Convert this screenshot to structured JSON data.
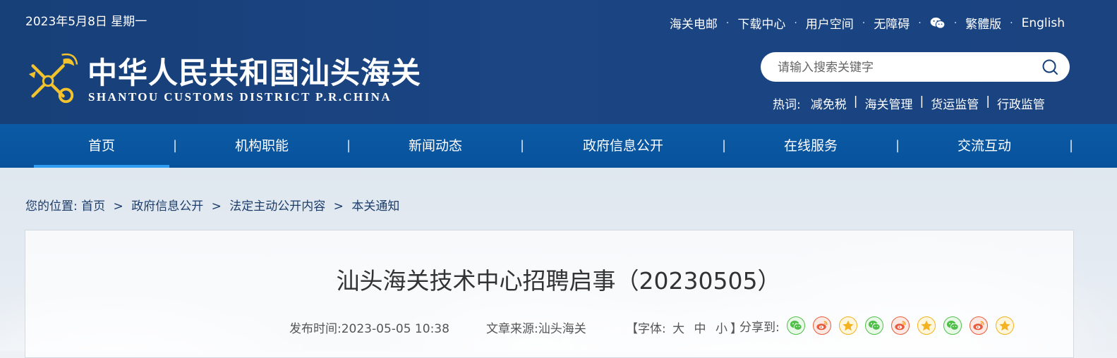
{
  "header": {
    "date": "2023年5月8日 星期一",
    "top_links": [
      "海关电邮",
      "下载中心",
      "用户空间",
      "无障碍",
      "繁體版",
      "English"
    ],
    "wechat_icon": "wechat-icon",
    "logo_cn": "中华人民共和国汕头海关",
    "logo_en": "SHANTOU CUSTOMS DISTRICT P.R.CHINA",
    "search_placeholder": "请输入搜索关键字",
    "hot_label": "热词:",
    "hot_words": [
      "减免税",
      "海关管理",
      "货运监管",
      "行政监管"
    ]
  },
  "nav": {
    "items": [
      "首页",
      "机构职能",
      "新闻动态",
      "政府信息公开",
      "在线服务",
      "交流互动"
    ],
    "active_index": 0
  },
  "breadcrumb": {
    "label": "您的位置:",
    "items": [
      "首页",
      "政府信息公开",
      "法定主动公开内容",
      "本关通知"
    ]
  },
  "article": {
    "title": "汕头海关技术中心招聘启事（20230505）",
    "publish_label": "发布时间:",
    "publish_time": "2023-05-05 10:38",
    "source_label": "文章来源:",
    "source": "汕头海关",
    "font_open": "【字体:",
    "font_sizes": [
      "大",
      "中",
      "小"
    ],
    "font_close": "】",
    "share_label": "分享到:",
    "share_icons": [
      "wechat-icon",
      "weibo-icon",
      "qzone-icon",
      "wechat-icon",
      "weibo-icon",
      "qzone-icon",
      "wechat-icon",
      "weibo-icon",
      "qzone-icon"
    ]
  },
  "colors": {
    "header_bg": "#1b4583",
    "nav_bg": "#0b5aa5",
    "nav_active_underline": "#2e9cf0",
    "wechat_green": "#4fbf4a",
    "weibo_red": "#e85c3d",
    "qzone_yellow": "#f3b21f"
  }
}
